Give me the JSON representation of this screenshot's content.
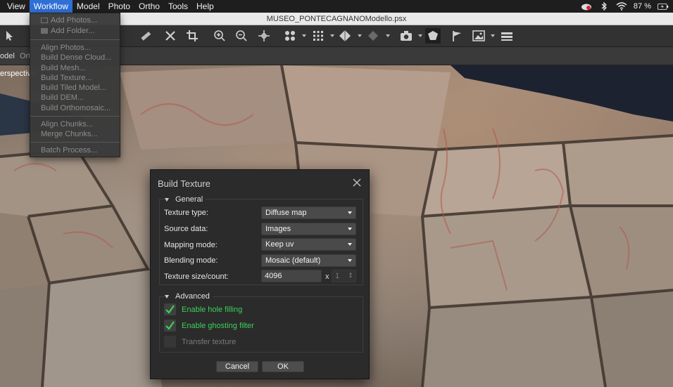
{
  "menubar": {
    "items": [
      "View",
      "Workflow",
      "Model",
      "Photo",
      "Ortho",
      "Tools",
      "Help"
    ],
    "active": "Workflow",
    "battery": "87 %"
  },
  "window": {
    "title": "MUSEO_PONTECAGNANOModello.psx"
  },
  "tabs": {
    "model_tab": "odel",
    "ortho_tab": "Ort"
  },
  "viewport": {
    "mode_label": "erspective"
  },
  "workflow_menu": {
    "items": [
      "Add Photos...",
      "Add Folder...",
      "Align Photos...",
      "Build Dense Cloud...",
      "Build Mesh...",
      "Build Texture...",
      "Build Tiled Model...",
      "Build DEM...",
      "Build Orthomosaic...",
      "Align Chunks...",
      "Merge Chunks...",
      "Batch Process..."
    ]
  },
  "dialog": {
    "title": "Build Texture",
    "general_header": "General",
    "fields": [
      {
        "label": "Texture type:",
        "value": "Diffuse map"
      },
      {
        "label": "Source data:",
        "value": "Images"
      },
      {
        "label": "Mapping mode:",
        "value": "Keep uv"
      },
      {
        "label": "Blending mode:",
        "value": "Mosaic (default)"
      }
    ],
    "texture_size": {
      "label": "Texture size/count:",
      "size": "4096",
      "separator": "x",
      "count": "1"
    },
    "advanced_header": "Advanced",
    "checks": [
      {
        "label": "Enable hole filling",
        "checked": true,
        "enabled": true
      },
      {
        "label": "Enable ghosting filter",
        "checked": true,
        "enabled": true
      },
      {
        "label": "Transfer texture",
        "checked": false,
        "enabled": false
      }
    ],
    "cancel_label": "Cancel",
    "ok_label": "OK"
  },
  "colors": {
    "menu_highlight": "#2f6fd6",
    "check_green": "#3dd05a"
  }
}
